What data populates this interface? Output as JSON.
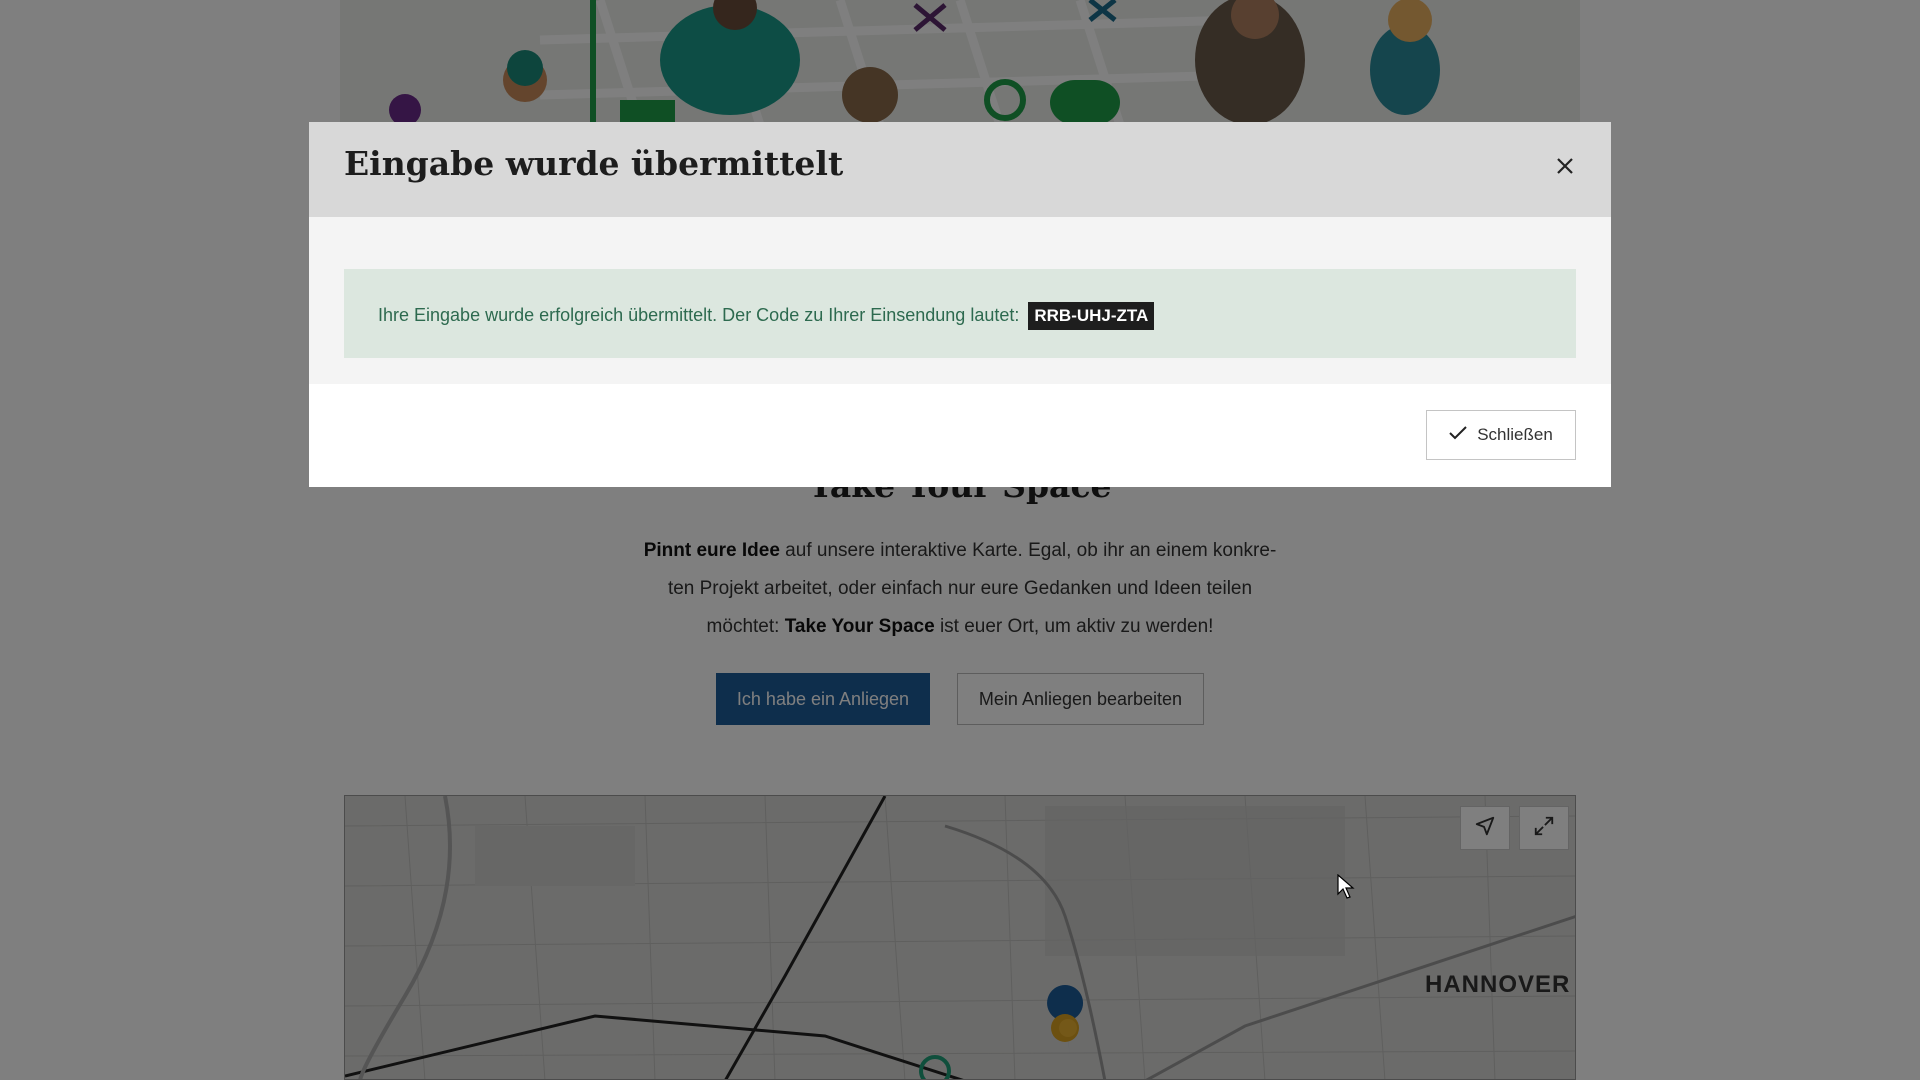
{
  "modal": {
    "title": "Eingabe wurde übermittelt",
    "message": "Ihre Eingabe wurde erfolgreich übermittelt. Der Code zu Ihrer Einsendung lautet:",
    "code": "RRB-UHJ-ZTA",
    "close_button_label": "Schließen",
    "close_icon": "close-icon",
    "check_icon": "check-icon"
  },
  "page": {
    "title": "Take Your Space",
    "intro": {
      "part1_bold": "Pinnt eure Idee",
      "part2": " auf unsere interaktive Karte. Egal, ob ihr an einem konkre-ten Projekt arbeitet, oder einfach nur eure Gedanken und Ideen teilen möchtet: ",
      "part3_bold": "Take Your Space",
      "part4": " ist euer Ort, um aktiv zu werden!"
    },
    "primary_button": "Ich habe ein Anliegen",
    "secondary_button": "Mein Anliegen bearbeiten"
  },
  "map": {
    "city_label": "HANNOVER",
    "controls": [
      "locate-icon",
      "fullscreen-icon"
    ]
  },
  "colors": {
    "primary": "#1c5c99",
    "alert_bg": "#dce7df",
    "alert_text": "#2d6a4f",
    "code_bg": "#1e1e1e"
  }
}
